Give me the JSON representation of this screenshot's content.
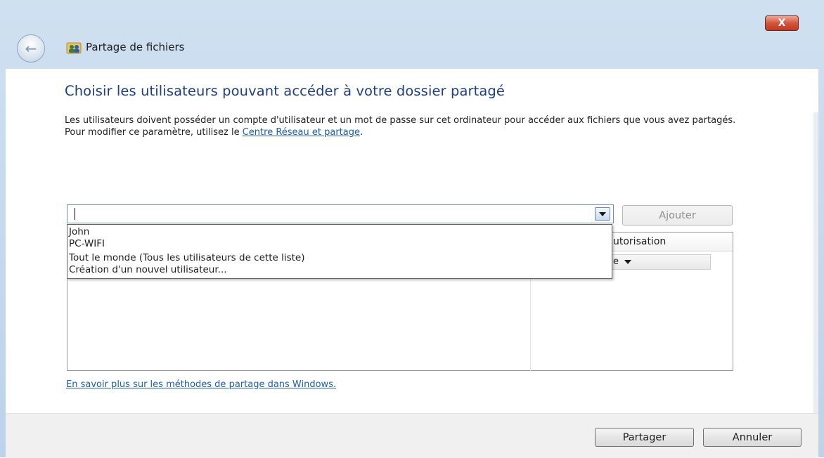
{
  "window": {
    "title": "Partage de fichiers",
    "close_label": "X"
  },
  "main": {
    "heading": "Choisir les utilisateurs pouvant accéder à votre dossier partagé",
    "description_text": "Les utilisateurs doivent posséder un compte d'utilisateur et un mot de passe sur cet ordinateur pour accéder aux fichiers que vous avez partagés. Pour modifier ce paramètre, utilisez le ",
    "description_link": "Centre Réseau et partage",
    "description_end": "."
  },
  "user_combo": {
    "value": "",
    "options": [
      "John",
      "PC-WIFI",
      "Tout le monde (Tous les utilisateurs de cette liste)",
      "Création d'un nouvel utilisateur..."
    ]
  },
  "add_button": "Ajouter",
  "user_list": {
    "permission_header": "utorisation",
    "permission_value": "e"
  },
  "learn_more_link": "En savoir plus sur les méthodes de partage dans Windows.",
  "footer": {
    "share_button": "Partager",
    "cancel_button": "Annuler"
  },
  "colors": {
    "heading": "#1e3f83",
    "link": "#1f5ea8",
    "close_button": "#c2381f"
  }
}
